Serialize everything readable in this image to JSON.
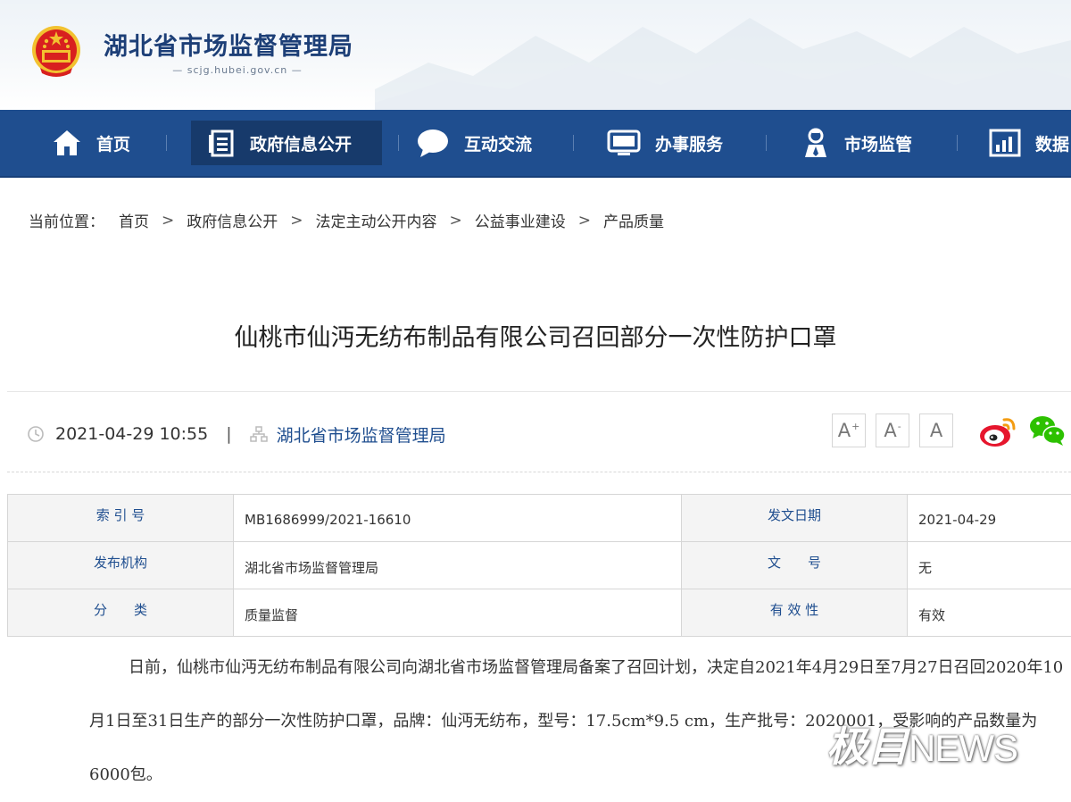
{
  "header": {
    "site_title": "湖北省市场监督管理局",
    "site_domain": "— scjg.hubei.gov.cn —"
  },
  "nav": {
    "items": [
      {
        "label": "首页",
        "icon": "home-icon"
      },
      {
        "label": "政府信息公开",
        "icon": "document-list-icon",
        "active": true
      },
      {
        "label": "互动交流",
        "icon": "chat-bubble-icon"
      },
      {
        "label": "办事服务",
        "icon": "monitor-icon"
      },
      {
        "label": "市场监管",
        "icon": "inspector-icon"
      },
      {
        "label": "数据",
        "icon": "bar-chart-icon"
      }
    ]
  },
  "breadcrumb": {
    "label": "当前位置：",
    "items": [
      "首页",
      "政府信息公开",
      "法定主动公开内容",
      "公益事业建设",
      "产品质量"
    ],
    "separator": ">"
  },
  "article": {
    "title": "仙桃市仙沔无纺布制品有限公司召回部分一次性防护口罩",
    "datetime": "2021-04-29 10:55",
    "publisher": "湖北省市场监督管理局",
    "font_controls": [
      "A+",
      "A-",
      "A"
    ],
    "share": [
      "weibo-icon",
      "wechat-icon"
    ]
  },
  "info_table": {
    "rows": [
      {
        "k1": "索 引 号",
        "v1": "MB1686999/2021-16610",
        "k2": "发文日期",
        "v2": "2021-04-29"
      },
      {
        "k1": "发布机构",
        "v1": "湖北省市场监督管理局",
        "k2": "文　　号",
        "v2": "无"
      },
      {
        "k1": "分　　类",
        "v1": "质量监督",
        "k2": "有 效 性",
        "v2": "有效"
      }
    ]
  },
  "body": {
    "paragraph": "日前，仙桃市仙沔无纺布制品有限公司向湖北省市场监督管理局备案了召回计划，决定自2021年4月29日至7月27日召回2020年10月1日至31日生产的部分一次性防护口罩，品牌：仙沔无纺布，型号：17.5cm*9.5 cm，生产批号：2020001，受影响的产品数量为6000包。"
  },
  "watermark": {
    "cn": "极目",
    "en": "NEWS"
  },
  "colors": {
    "nav_bg": "#1f4e8f",
    "nav_active": "#173a6b",
    "title_blue": "#1d3f77",
    "emblem_red": "#d8201f",
    "emblem_gold": "#f2c230"
  }
}
